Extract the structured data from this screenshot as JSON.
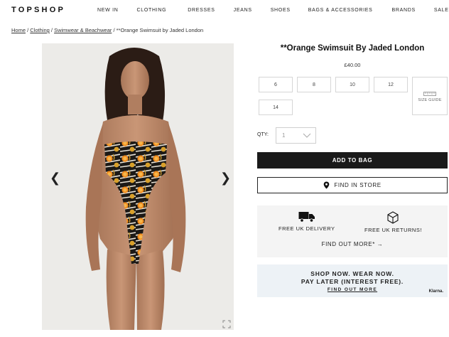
{
  "header": {
    "logo": "TOPSHOP",
    "nav": [
      "NEW IN",
      "CLOTHING",
      "DRESSES",
      "JEANS",
      "SHOES",
      "BAGS & ACCESSORIES",
      "BRANDS",
      "SALE"
    ]
  },
  "breadcrumb": {
    "home": "Home",
    "sep": " / ",
    "clothing": "Clothing",
    "swimwear": "Swimwear & Beachwear",
    "current": "**Orange Swimsuit by Jaded London"
  },
  "gallery": {
    "prev_icon": "chevron-left-icon",
    "next_icon": "chevron-right-icon",
    "expand_icon": "expand-icon"
  },
  "product": {
    "title": "**Orange Swimsuit By Jaded London",
    "price": "£40.00",
    "sizes": [
      "6",
      "8",
      "10",
      "12",
      "14"
    ],
    "size_guide": "SIZE GUIDE",
    "qty_label": "QTY:",
    "qty_value": "1",
    "add_to_bag": "ADD TO BAG",
    "find_in_store": "FIND IN STORE"
  },
  "delivery": {
    "uk_delivery": "FREE UK DELIVERY",
    "uk_returns": "FREE UK RETURNS!",
    "find_out_more": "FIND OUT MORE* →"
  },
  "klarna": {
    "line1": "SHOP NOW. WEAR NOW.",
    "line2": "PAY LATER (INTEREST FREE).",
    "line3": "FIND OUT MORE",
    "brand": "Klarna."
  },
  "colors": {
    "accent": "#1a1a1a",
    "delivery_bg": "#f4f4f4",
    "klarna_bg": "#edf2f6"
  }
}
